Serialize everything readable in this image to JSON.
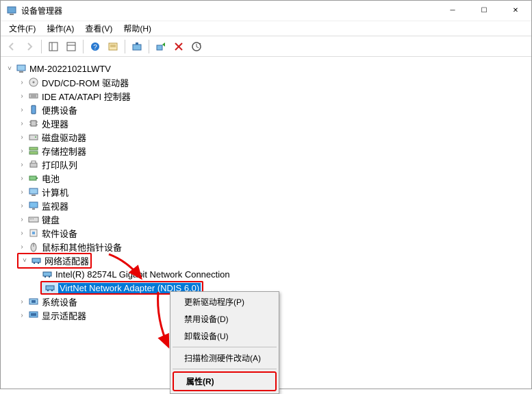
{
  "title": "设备管理器",
  "menus": {
    "file": "文件(F)",
    "action": "操作(A)",
    "view": "查看(V)",
    "help": "帮助(H)"
  },
  "root": "MM-20221021LWTV",
  "categories": {
    "dvd": "DVD/CD-ROM 驱动器",
    "ide": "IDE ATA/ATAPI 控制器",
    "portable": "便携设备",
    "cpu": "处理器",
    "disk": "磁盘驱动器",
    "storage": "存储控制器",
    "printq": "打印队列",
    "battery": "电池",
    "computer": "计算机",
    "monitor": "监视器",
    "keyboard": "键盘",
    "software": "软件设备",
    "mouse": "鼠标和其他指针设备",
    "network": "网络适配器",
    "system": "系统设备",
    "display": "显示适配器"
  },
  "network_children": {
    "intel": "Intel(R) 82574L Gigabit Network Connection",
    "virtnet": "VirtNet Network Adapter (NDIS 6.0)"
  },
  "ctx": {
    "update": "更新驱动程序(P)",
    "disable": "禁用设备(D)",
    "uninstall": "卸载设备(U)",
    "scan": "扫描检测硬件改动(A)",
    "properties": "属性(R)"
  }
}
